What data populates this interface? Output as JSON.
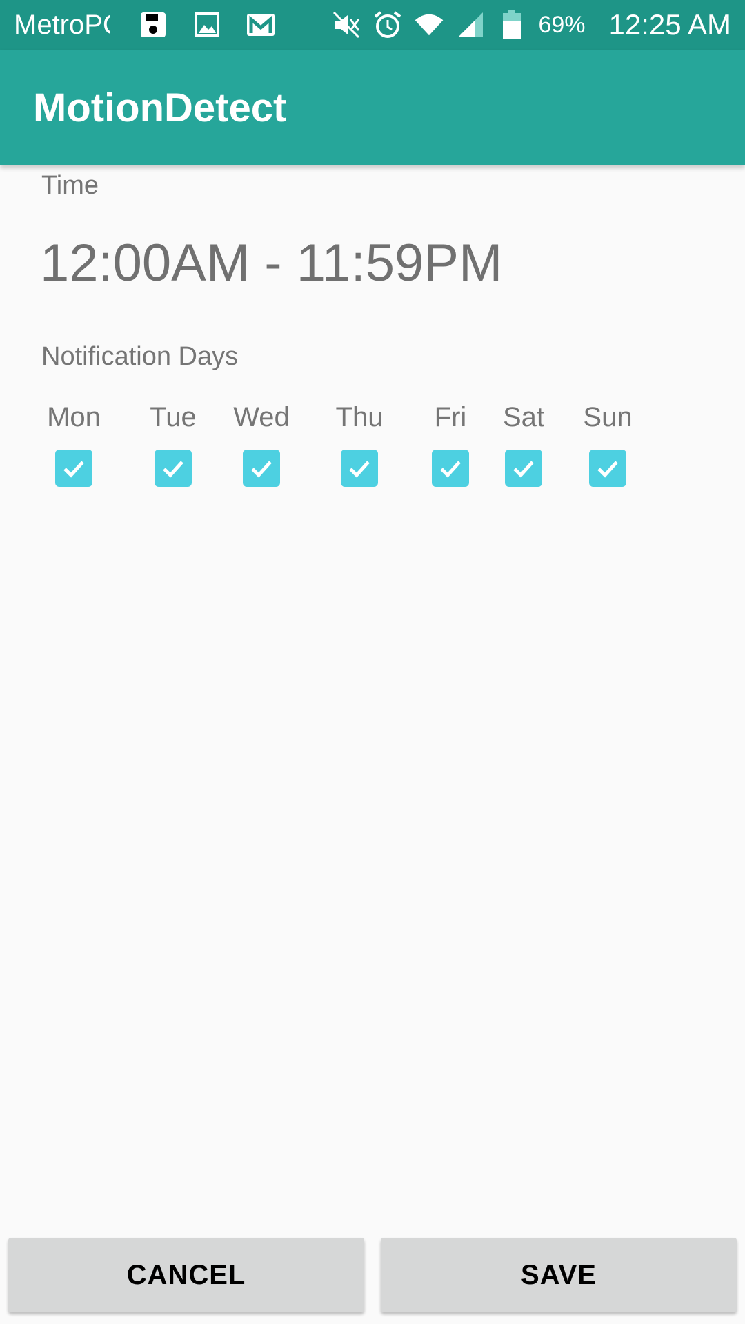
{
  "status_bar": {
    "carrier": "MetroPCS",
    "battery_percent": "69%",
    "time": "12:25 AM",
    "left_icons": [
      "save-icon",
      "image-icon",
      "gmail-icon"
    ],
    "right_icons": [
      "mute-icon",
      "alarm-icon",
      "wifi-icon",
      "signal-icon",
      "battery-icon"
    ]
  },
  "app_bar": {
    "title": "MotionDetect"
  },
  "time_section": {
    "label": "Time",
    "value": "12:00AM - 11:59PM"
  },
  "days_section": {
    "label": "Notification Days",
    "days": [
      {
        "label": "Mon",
        "checked": true
      },
      {
        "label": "Tue",
        "checked": true
      },
      {
        "label": "Wed",
        "checked": true
      },
      {
        "label": "Thu",
        "checked": true
      },
      {
        "label": "Fri",
        "checked": true
      },
      {
        "label": "Sat",
        "checked": true
      },
      {
        "label": "Sun",
        "checked": true
      }
    ]
  },
  "buttons": {
    "cancel_label": "CANCEL",
    "save_label": "SAVE"
  },
  "colors": {
    "status_bar": "#1e9587",
    "app_bar": "#26a69a",
    "checkbox": "#4dd0e1",
    "button_bg": "#d6d7d7"
  }
}
